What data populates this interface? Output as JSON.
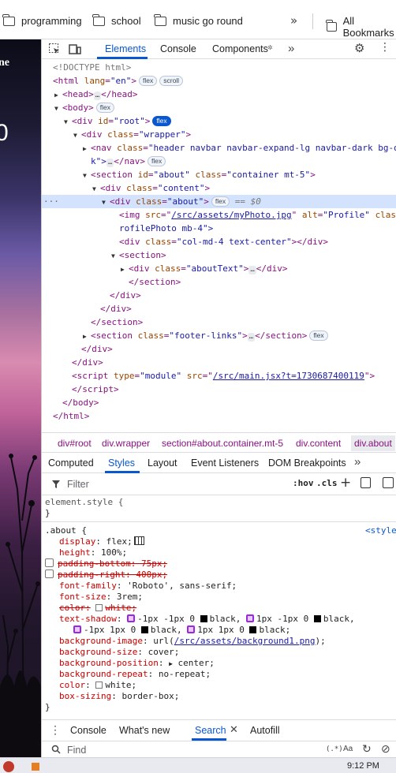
{
  "bookmarks": [
    {
      "label": "programming"
    },
    {
      "label": "school"
    },
    {
      "label": "music go round"
    }
  ],
  "bookmarks_more": "»",
  "all_bookmarks": "All Bookmarks",
  "page": {
    "text_top": "ne",
    "text_mid": "0"
  },
  "devtools": {
    "tabs": [
      "Elements",
      "Console",
      "Components"
    ],
    "more": "»",
    "dom": {
      "l1": "<!DOCTYPE html>",
      "html_lang_attr": "lang",
      "html_lang_val": "\"en\"",
      "badge_flex": "flex",
      "badge_scroll": "scroll",
      "head": "head",
      "body": "body",
      "root_id": "\"root\"",
      "wrapper_class": "\"wrapper\"",
      "nav_class": "\"header navbar navbar-expand-lg navbar-dark bg-d",
      "nav_cont": "k\">",
      "section_id": "\"about\"",
      "section_class": "\"container mt-5\"",
      "content_class": "\"content\"",
      "about_class": "\"about\"",
      "dollar": "== $0",
      "img_src": "/src/assets/myPhoto.jpg",
      "img_alt": "\"Profile\"",
      "img_class": "class",
      "img_cont": "rofilePhoto mb-4\">",
      "col_class": "\"col-md-4 text-center\"",
      "abouttext_class": "\"aboutText\"",
      "footer_class": "\"footer-links\"",
      "script_type": "\"module\"",
      "script_src": "/src/main.jsx?t=1730687400119"
    },
    "breadcrumbs": [
      "div#root",
      "div.wrapper",
      "section#about.container.mt-5",
      "div.content",
      "div.about"
    ],
    "style_tabs": [
      "Computed",
      "Styles",
      "Layout",
      "Event Listeners",
      "DOM Breakpoints"
    ],
    "filter_placeholder": "Filter",
    "hov": ":hov",
    "cls": ".cls",
    "styles": {
      "element_style": "element.style {",
      "close": "}",
      "selector": ".about {",
      "source": "<style",
      "props": {
        "display": "flex;",
        "height": "100%;",
        "padding_bottom": "padding-bottom: 75px;",
        "padding_right": "padding-right: 400px;",
        "font_family": "'Roboto', sans-serif;",
        "font_size": "3rem;",
        "color_struck": "color:",
        "color_struck_val": "white;",
        "text_shadow_1": "-1px -1px 0",
        "text_shadow_1b": "black,",
        "text_shadow_2": "1px -1px 0",
        "text_shadow_2b": "black,",
        "text_shadow_3": "-1px 1px 0",
        "text_shadow_3b": "black,",
        "text_shadow_4": "1px 1px 0",
        "text_shadow_4b": "black;",
        "bg_image_fn": "url(",
        "bg_image_url": "/src/assets/background1.png",
        "bg_image_end": ");",
        "bg_size": "cover;",
        "bg_position": "center;",
        "bg_repeat": "no-repeat;",
        "color": "white;",
        "box_sizing": "border-box;"
      }
    },
    "drawer_tabs": [
      "Console",
      "What's new",
      "Search",
      "Autofill"
    ],
    "find_placeholder": "Find",
    "aa": "Aa",
    "regex": "(.*)"
  },
  "taskbar": {
    "time": "9:12 PM"
  }
}
